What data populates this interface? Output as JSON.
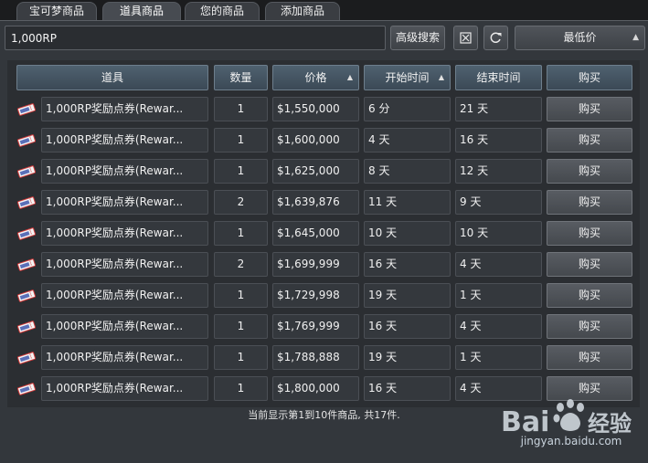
{
  "tabs": [
    {
      "label": "宝可梦商品"
    },
    {
      "label": "道具商品"
    },
    {
      "label": "您的商品"
    },
    {
      "label": "添加商品"
    }
  ],
  "search": {
    "value": "1,000RP",
    "advanced_label": "高级搜索",
    "sort_value": "最低价"
  },
  "table": {
    "headers": [
      "道具",
      "数量",
      "价格",
      "开始时间",
      "结束时间",
      "购买"
    ],
    "buy_label": "购买",
    "rows": [
      {
        "item": "1,000RP奖励点券(Rewar...",
        "qty": "1",
        "price": "$1,550,000",
        "start": "6 分",
        "end": "21 天"
      },
      {
        "item": "1,000RP奖励点券(Rewar...",
        "qty": "1",
        "price": "$1,600,000",
        "start": "4 天",
        "end": "16 天"
      },
      {
        "item": "1,000RP奖励点券(Rewar...",
        "qty": "1",
        "price": "$1,625,000",
        "start": "8 天",
        "end": "12 天"
      },
      {
        "item": "1,000RP奖励点券(Rewar...",
        "qty": "2",
        "price": "$1,639,876",
        "start": "11 天",
        "end": "9 天"
      },
      {
        "item": "1,000RP奖励点券(Rewar...",
        "qty": "1",
        "price": "$1,645,000",
        "start": "10 天",
        "end": "10 天"
      },
      {
        "item": "1,000RP奖励点券(Rewar...",
        "qty": "2",
        "price": "$1,699,999",
        "start": "16 天",
        "end": "4 天"
      },
      {
        "item": "1,000RP奖励点券(Rewar...",
        "qty": "1",
        "price": "$1,729,998",
        "start": "19 天",
        "end": "1 天"
      },
      {
        "item": "1,000RP奖励点券(Rewar...",
        "qty": "1",
        "price": "$1,769,999",
        "start": "16 天",
        "end": "4 天"
      },
      {
        "item": "1,000RP奖励点券(Rewar...",
        "qty": "1",
        "price": "$1,788,888",
        "start": "19 天",
        "end": "1 天"
      },
      {
        "item": "1,000RP奖励点券(Rewar...",
        "qty": "1",
        "price": "$1,800,000",
        "start": "16 天",
        "end": "4 天"
      }
    ]
  },
  "footer": {
    "status": "当前显示第1到10件商品, 共17件."
  },
  "watermark": {
    "brand": "Bai 经验",
    "site": "jingyan.baidu.com"
  },
  "icons": {
    "reset": "reset-x-icon",
    "refresh": "refresh-icon",
    "ticket": "ticket-icon"
  },
  "colors": {
    "header_blue": "#4f6170",
    "panel": "#33373c",
    "ticket_red": "#d23a3a"
  }
}
